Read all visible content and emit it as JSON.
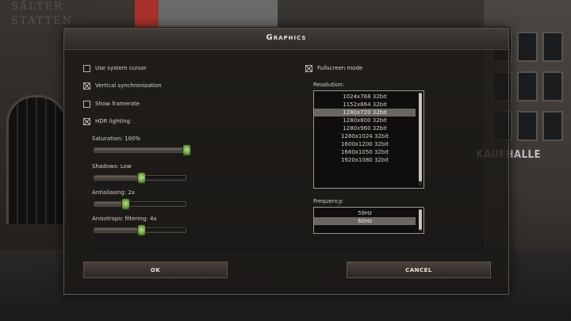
{
  "background": {
    "left_sign": "SÄLTER\nSTATTEN",
    "right_sign": "KAUFHALLE"
  },
  "dialog": {
    "title": "Graphics",
    "options_left": [
      {
        "label": "Use system cursor",
        "checked": false
      },
      {
        "label": "Vertical synchronization",
        "checked": true
      },
      {
        "label": "Show framerate",
        "checked": false
      },
      {
        "label": "HDR lighting",
        "checked": true
      }
    ],
    "sliders": [
      {
        "label": "Saturation: 100%",
        "value": 1.0
      },
      {
        "label": "Shadows: Low",
        "value": 0.5
      },
      {
        "label": "Antialiasing: 2x",
        "value": 0.33
      },
      {
        "label": "Anisotropic filtering: 4x",
        "value": 0.5
      }
    ],
    "fullscreen": {
      "label": "Fullscreen mode",
      "checked": true
    },
    "resolution": {
      "label": "Resolution:",
      "options": [
        "1024x768 32bit",
        "1152x864 32bit",
        "1280x720 32bit",
        "1280x800 32bit",
        "1280x960 32bit",
        "1280x1024 32bit",
        "1600x1200 32bit",
        "1680x1050 32bit",
        "1920x1080 32bit"
      ],
      "selected_index": 2
    },
    "frequency": {
      "label": "Frequency:",
      "options": [
        "59Hz",
        "60Hz"
      ],
      "selected_index": 1
    },
    "ok_label": "OK",
    "cancel_label": "CANCEL"
  }
}
